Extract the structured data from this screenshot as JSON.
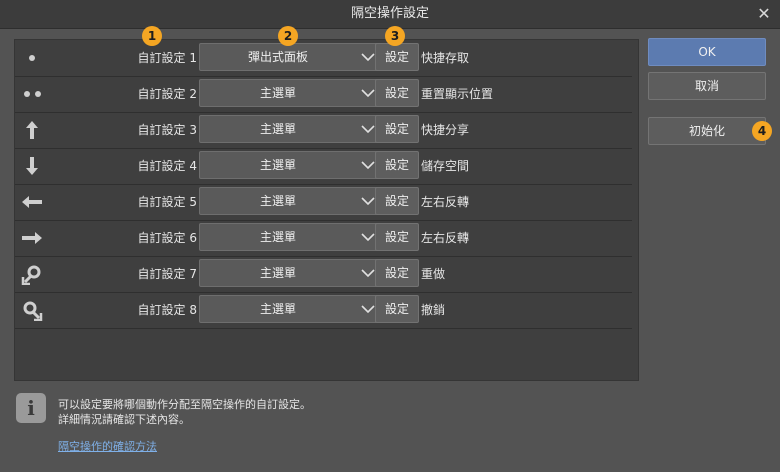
{
  "window": {
    "title": "隔空操作設定",
    "close_icon": "close-icon"
  },
  "rows": [
    {
      "gesture_icon": "dot-icon",
      "label": "自訂設定 1：",
      "combo": "彈出式面板",
      "set_label": "設定",
      "action": "快捷存取"
    },
    {
      "gesture_icon": "double-dot-icon",
      "label": "自訂設定 2：",
      "combo": "主選單",
      "set_label": "設定",
      "action": "重置顯示位置"
    },
    {
      "gesture_icon": "arrow-up-icon",
      "label": "自訂設定 3：",
      "combo": "主選單",
      "set_label": "設定",
      "action": "快捷分享"
    },
    {
      "gesture_icon": "arrow-down-icon",
      "label": "自訂設定 4：",
      "combo": "主選單",
      "set_label": "設定",
      "action": "儲存空間"
    },
    {
      "gesture_icon": "arrow-left-icon",
      "label": "自訂設定 5：",
      "combo": "主選單",
      "set_label": "設定",
      "action": "左右反轉"
    },
    {
      "gesture_icon": "arrow-right-icon",
      "label": "自訂設定 6：",
      "combo": "主選單",
      "set_label": "設定",
      "action": "左右反轉"
    },
    {
      "gesture_icon": "loop-counterclockwise-icon",
      "label": "自訂設定 7：",
      "combo": "主選單",
      "set_label": "設定",
      "action": "重做"
    },
    {
      "gesture_icon": "loop-clockwise-icon",
      "label": "自訂設定 8：",
      "combo": "主選單",
      "set_label": "設定",
      "action": "撤銷"
    }
  ],
  "buttons": {
    "ok": "OK",
    "cancel": "取消",
    "reset": "初始化"
  },
  "badges": [
    "1",
    "2",
    "3",
    "4"
  ],
  "info": {
    "icon": "info-icon",
    "line1": "可以設定要將哪個動作分配至隔空操作的自訂設定。",
    "line2": "詳細情況請確認下述內容。",
    "link": "隔空操作的確認方法"
  },
  "colors": {
    "accent": "#5c7bb0",
    "badge": "#f5a623",
    "link": "#7fb0e8"
  }
}
